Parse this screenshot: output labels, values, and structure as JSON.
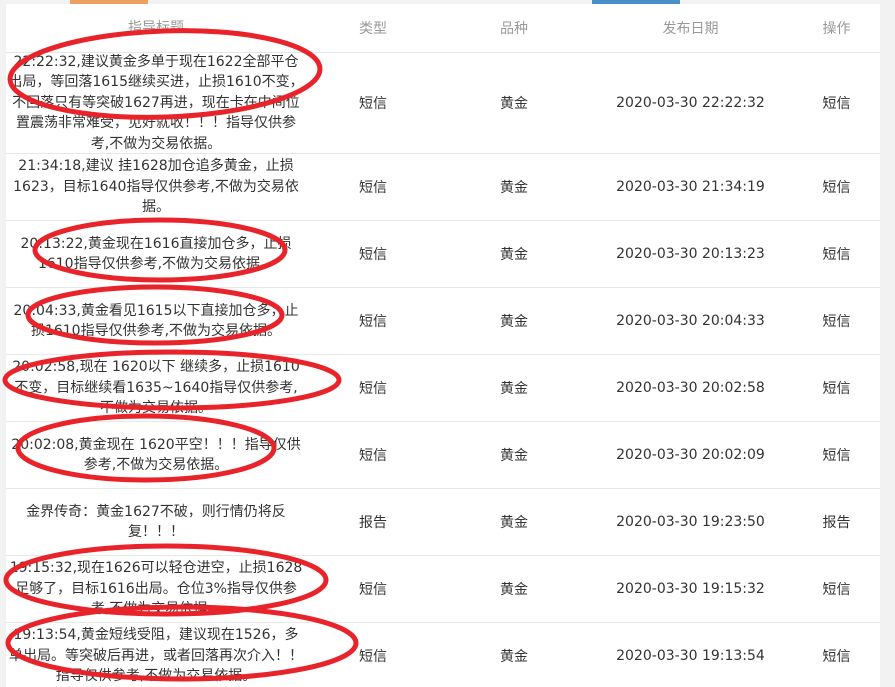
{
  "header": {
    "title": "指导标题",
    "type": "类型",
    "variety": "品种",
    "date": "发布日期",
    "action": "操作"
  },
  "rows": [
    {
      "title": "22:22:32,建议黄金多单于现在1622全部平仓出局，等回落1615继续买进，止损1610不变，不回落只有等突破1627再进，现在卡在中间位置震荡非常难受，见好就收！！！指导仅供参考,不做为交易依据。",
      "type": "短信",
      "variety": "黄金",
      "date": "2020-03-30 22:22:32",
      "action": "短信"
    },
    {
      "title": "21:34:18,建议 挂1628加仓追多黄金，止损1623，目标1640指导仅供参考,不做为交易依据。",
      "type": "短信",
      "variety": "黄金",
      "date": "2020-03-30 21:34:19",
      "action": "短信"
    },
    {
      "title": "20:13:22,黄金现在1616直接加仓多，止损1610指导仅供参考,不做为交易依据。",
      "type": "短信",
      "variety": "黄金",
      "date": "2020-03-30 20:13:23",
      "action": "短信"
    },
    {
      "title": "20:04:33,黄金看见1615以下直接加仓多，止损1610指导仅供参考,不做为交易依据。",
      "type": "短信",
      "variety": "黄金",
      "date": "2020-03-30 20:04:33",
      "action": "短信"
    },
    {
      "title": "20:02:58,现在 1620以下 继续多，止损1610不变，目标继续看1635~1640指导仅供参考,不做为交易依据。",
      "type": "短信",
      "variety": "黄金",
      "date": "2020-03-30 20:02:58",
      "action": "短信"
    },
    {
      "title": "20:02:08,黄金现在 1620平空！！！指导仅供参考,不做为交易依据。",
      "type": "短信",
      "variety": "黄金",
      "date": "2020-03-30 20:02:09",
      "action": "短信"
    },
    {
      "title": "金界传奇：黄金1627不破，则行情仍将反复！！！",
      "type": "报告",
      "variety": "黄金",
      "date": "2020-03-30 19:23:50",
      "action": "报告"
    },
    {
      "title": "19:15:32,现在1626可以轻仓进空，止损1628足够了，目标1616出局。仓位3%指导仅供参考,不做为交易依据。",
      "type": "短信",
      "variety": "黄金",
      "date": "2020-03-30 19:15:32",
      "action": "短信"
    },
    {
      "title": "19:13:54,黄金短线受阻，建议现在1526，多单出局。等突破后再进，或者回落再次介入！！指导仅供参考,不做为交易依据。",
      "type": "短信",
      "variety": "黄金",
      "date": "2020-03-30 19:13:54",
      "action": "短信"
    }
  ],
  "colors": {
    "annotation": "#e8232a",
    "header_text": "#999999",
    "tab_accent_orange": "#f0a060",
    "tab_accent_blue": "#4a90c8"
  }
}
